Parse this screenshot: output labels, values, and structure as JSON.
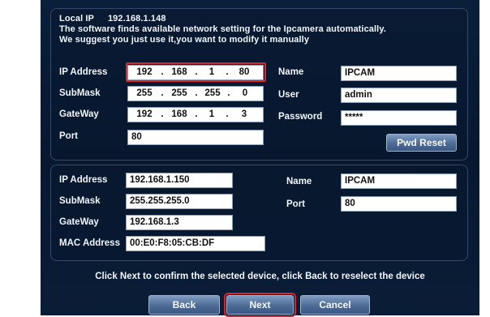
{
  "detected": {
    "local_ip_label": "Local IP",
    "local_ip_value": "192.168.1.148",
    "line1": "The software finds available network setting for the Ipcamera automatically.",
    "line2": "We suggest you just use it,you want to modify it manually"
  },
  "setting": {
    "ip_label": "IP Address",
    "ip_octets": [
      "192",
      "168",
      "1",
      "80"
    ],
    "submask_label": "SubMask",
    "submask_octets": [
      "255",
      "255",
      "255",
      "0"
    ],
    "gateway_label": "GateWay",
    "gateway_octets": [
      "192",
      "168",
      "1",
      "3"
    ],
    "port_label": "Port",
    "port_value": "80",
    "name_label": "Name",
    "name_value": "IPCAM",
    "user_label": "User",
    "user_value": "admin",
    "password_label": "Password",
    "password_value": "*****",
    "pwd_reset_label": "Pwd Reset",
    "dot": "."
  },
  "device": {
    "ip_label": "IP Address",
    "ip_value": "192.168.1.150",
    "submask_label": "SubMask",
    "submask_value": "255.255.255.0",
    "gateway_label": "GateWay",
    "gateway_value": "192.168.1.3",
    "mac_label": "MAC Address",
    "mac_value": "00:E0:F8:05:CB:DF",
    "name_label": "Name",
    "name_value": "IPCAM",
    "port_label": "Port",
    "port_value": "80"
  },
  "instruction": "Click Next to confirm the selected device, click Back to reselect the device",
  "buttons": {
    "back": "Back",
    "next": "Next",
    "cancel": "Cancel"
  },
  "colors": {
    "background": "#0a1f3a",
    "highlight": "#d8262c",
    "button": "#4d6b95"
  }
}
